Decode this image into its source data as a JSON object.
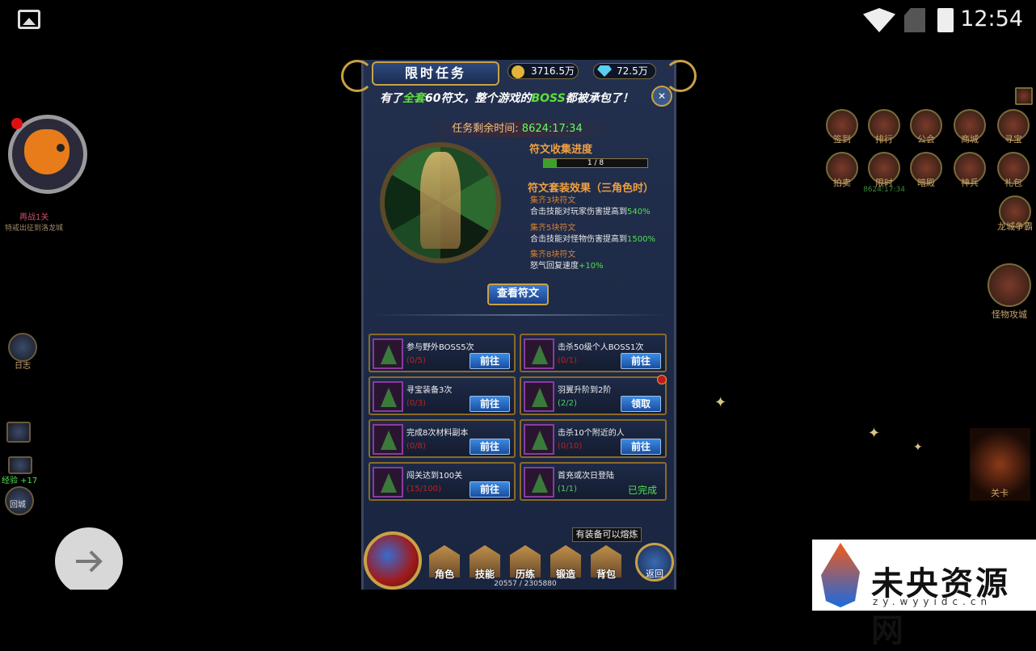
{
  "status_bar": {
    "time": "12:54",
    "icons": [
      "image-icon",
      "wifi-icon",
      "no-sim-icon",
      "battery-icon"
    ]
  },
  "left_hud": {
    "stage_label": "再战1关",
    "stage_sub": "特戒出征到洛龙城",
    "exp_label": "经验 +17",
    "mail_icon": "mail-icon",
    "journal_label": "日志",
    "city_label": "回城"
  },
  "right_hud": {
    "icons": [
      {
        "label": "签到"
      },
      {
        "label": "排行"
      },
      {
        "label": "公会"
      },
      {
        "label": "商城"
      },
      {
        "label": "寻宝"
      },
      {
        "label": "拍卖"
      },
      {
        "label": "限时"
      },
      {
        "label": "暗殿"
      },
      {
        "label": "神兵"
      },
      {
        "label": "礼包"
      }
    ],
    "timer_small": "8624:17:34",
    "longcheng_label": "龙城争霸",
    "monster_label": "怪物攻城",
    "boss_label": "关卡"
  },
  "panel": {
    "title": "限时任务",
    "gold": "3716.5万",
    "diamond": "72.5万",
    "banner_pre": "有了",
    "banner_highlight": "全套",
    "banner_mid": "60符文，整个游戏的",
    "banner_boss": "BOSS",
    "banner_post": "都被承包了！",
    "timer_label": "任务剩余时间:",
    "timer_value": "8624:17:34",
    "collect_title": "符文收集进度",
    "collect_progress": "1 / 8",
    "collect_fraction": 0.125,
    "effect_title": "符文套装效果（三角色时）",
    "effects": [
      {
        "title": "集齐3块符文",
        "desc": "合击技能对玩家伤害提高到",
        "value": "540%"
      },
      {
        "title": "集齐5块符文",
        "desc": "合击技能对怪物伤害提高到",
        "value": "1500%"
      },
      {
        "title": "集齐8块符文",
        "desc": "怒气回复速度",
        "value": "+10%"
      }
    ],
    "view_button": "查看符文",
    "tasks": [
      {
        "name": "参与野外BOSS5次",
        "progress": "(0/5)",
        "action": "前往",
        "done": false
      },
      {
        "name": "击杀50级个人BOSS1次",
        "progress": "(0/1)",
        "action": "前往",
        "done": false
      },
      {
        "name": "寻宝装备3次",
        "progress": "(0/3)",
        "action": "前往",
        "done": false
      },
      {
        "name": "羽翼升阶到2阶",
        "progress": "(2/2)",
        "action": "领取",
        "done": false
      },
      {
        "name": "完成8次材料副本",
        "progress": "(0/8)",
        "action": "前往",
        "done": false
      },
      {
        "name": "击杀10个附近的人",
        "progress": "(0/10)",
        "action": "前往",
        "done": false
      },
      {
        "name": "闯关达到100关",
        "progress": "(15/100)",
        "action": "前往",
        "done": false
      },
      {
        "name": "首充或次日登陆",
        "progress": "(1/1)",
        "action": "已完成",
        "done": true
      }
    ]
  },
  "bottom": {
    "tooltip": "有装备可以熔炼",
    "buttons": [
      "角色",
      "技能",
      "历练",
      "锻造",
      "背包"
    ],
    "back_label": "返回",
    "hp_text": "20557 / 2305880"
  },
  "watermark": {
    "text": "未央资源网",
    "url": "zy.wyyidc.cn"
  }
}
